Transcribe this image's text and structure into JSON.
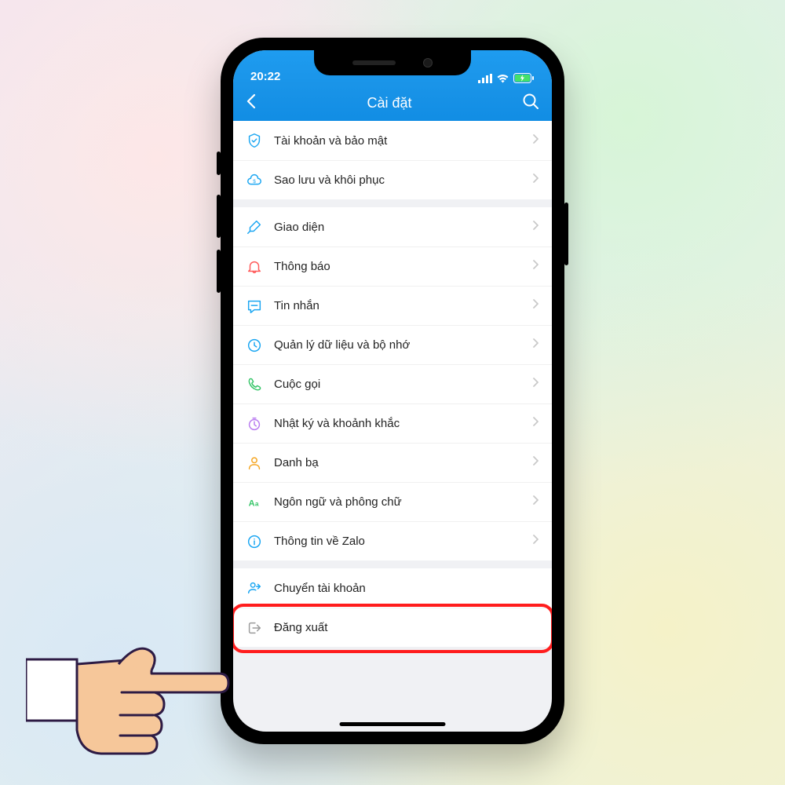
{
  "status": {
    "time": "20:22"
  },
  "nav": {
    "title": "Cài đặt"
  },
  "groups": [
    {
      "rows": [
        {
          "id": "account-security",
          "label": "Tài khoản và bảo mật",
          "icon": "shield",
          "color": "#1aa6f2",
          "chevron": true
        },
        {
          "id": "backup-restore",
          "label": "Sao lưu và khôi phục",
          "icon": "cloud",
          "color": "#1aa6f2",
          "chevron": true
        }
      ]
    },
    {
      "rows": [
        {
          "id": "appearance",
          "label": "Giao diện",
          "icon": "brush",
          "color": "#1aa6f2",
          "chevron": true
        },
        {
          "id": "notifications",
          "label": "Thông báo",
          "icon": "bell",
          "color": "#ff5a5a",
          "chevron": true
        },
        {
          "id": "messages",
          "label": "Tin nhắn",
          "icon": "chat",
          "color": "#1aa6f2",
          "chevron": true
        },
        {
          "id": "data-storage",
          "label": "Quản lý dữ liệu và bộ nhớ",
          "icon": "clock",
          "color": "#1aa6f2",
          "chevron": true
        },
        {
          "id": "calls",
          "label": "Cuộc gọi",
          "icon": "phone",
          "color": "#33c466",
          "chevron": true
        },
        {
          "id": "timeline",
          "label": "Nhật ký và khoảnh khắc",
          "icon": "timer",
          "color": "#b97cf0",
          "chevron": true
        },
        {
          "id": "contacts",
          "label": "Danh bạ",
          "icon": "person",
          "color": "#f5a623",
          "chevron": true
        },
        {
          "id": "language-font",
          "label": "Ngôn ngữ và phông chữ",
          "icon": "aa",
          "color": "#33c466",
          "chevron": true
        },
        {
          "id": "about",
          "label": "Thông tin về Zalo",
          "icon": "info",
          "color": "#1aa6f2",
          "chevron": true
        }
      ]
    },
    {
      "rows": [
        {
          "id": "switch-account",
          "label": "Chuyển tài khoản",
          "icon": "switch",
          "color": "#1aa6f2",
          "chevron": false
        },
        {
          "id": "logout",
          "label": "Đăng xuất",
          "icon": "logout",
          "color": "#9b9b9b",
          "chevron": false,
          "highlight": true
        }
      ]
    }
  ]
}
